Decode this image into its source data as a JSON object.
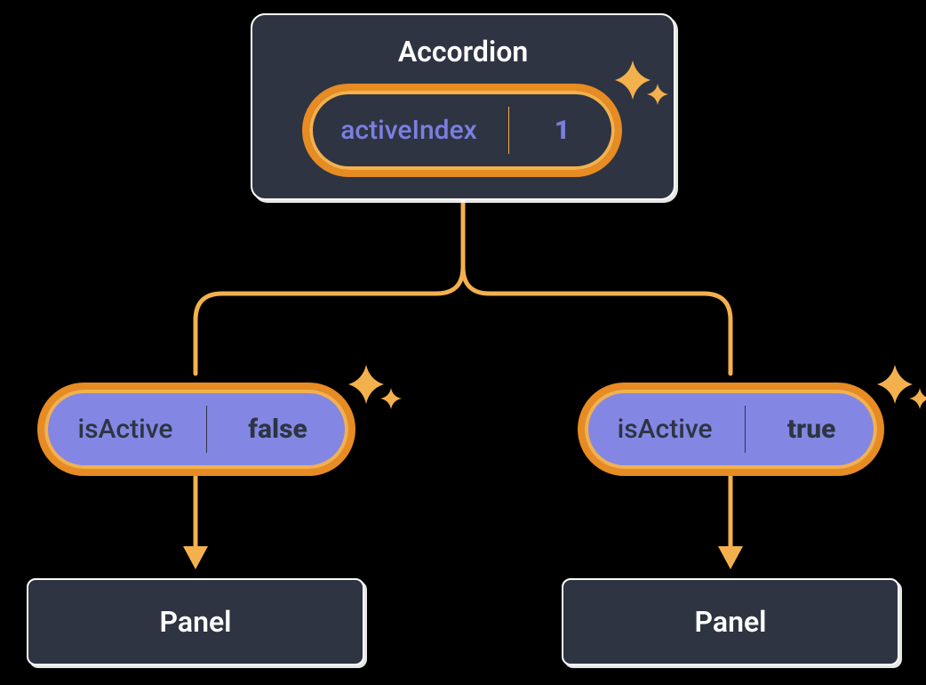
{
  "parent": {
    "title": "Accordion",
    "state_key": "activeIndex",
    "state_value": "1"
  },
  "children": [
    {
      "prop_key": "isActive",
      "prop_value": "false",
      "label": "Panel"
    },
    {
      "prop_key": "isActive",
      "prop_value": "true",
      "label": "Panel"
    }
  ],
  "colors": {
    "node_bg": "#2E3442",
    "pill_border_outer": "#E78B23",
    "pill_border_inner": "#F3B14E",
    "lilac": "#8387E3",
    "purple_text": "#7B7FE0",
    "connector": "#F3B14E"
  }
}
